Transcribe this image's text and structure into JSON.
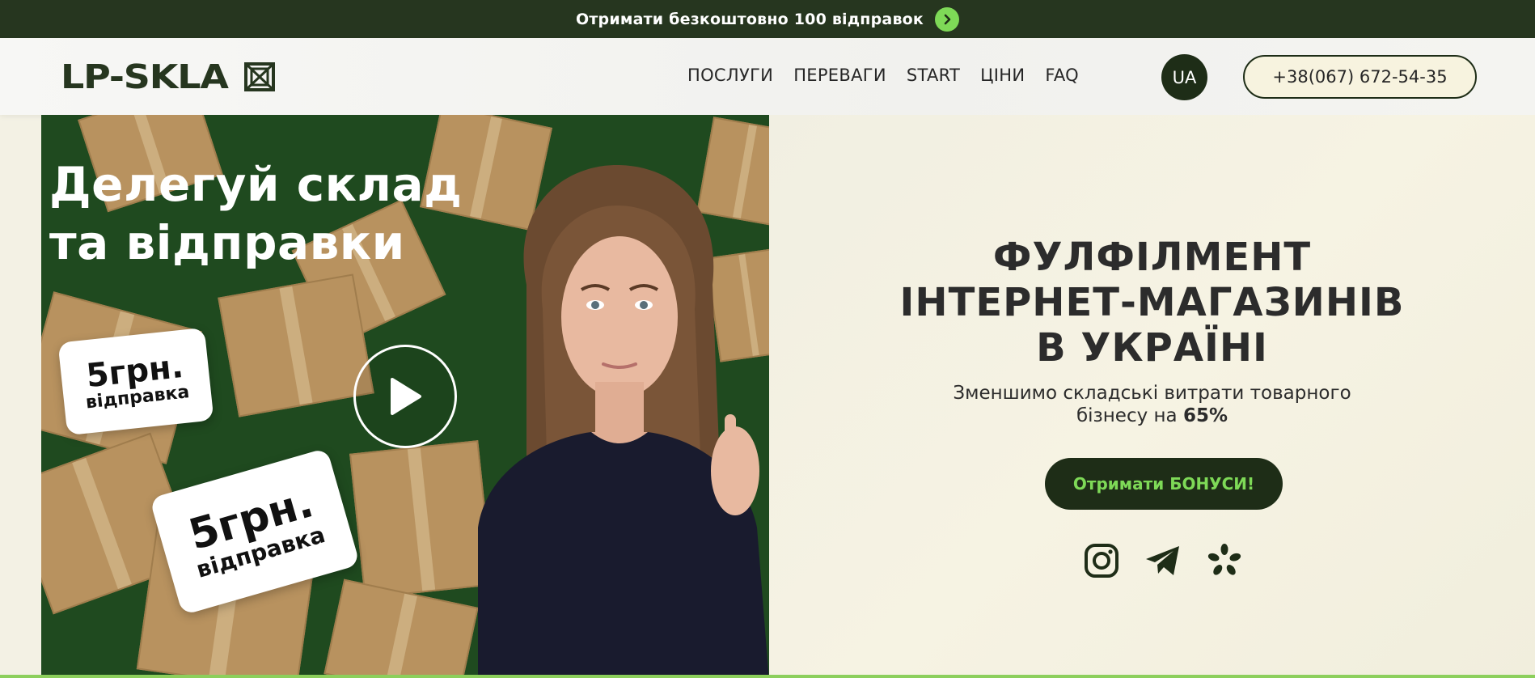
{
  "promo": {
    "text": "Отримати безкоштовно 100 відправок",
    "arrow_icon": "chevron-right-icon"
  },
  "header": {
    "logo_text": "LP-SKLA",
    "nav": [
      "ПОСЛУГИ",
      "ПЕРЕВАГИ",
      "START",
      "ЦІНИ",
      "FAQ"
    ],
    "lang": "UA",
    "phone": "+38(067) 672-54-35"
  },
  "video": {
    "title_line1": "Делегуй склад",
    "title_line2": "та відправки",
    "badge1": {
      "price": "5грн.",
      "sub": "відправка"
    },
    "badge2": {
      "price": "5грн.",
      "sub": "відправка"
    },
    "play_icon": "play-icon"
  },
  "hero": {
    "headline_line1": "ФУЛФІЛМЕНТ",
    "headline_line2": "ІНТЕРНЕТ-МАГАЗИНІВ",
    "headline_line3": "В УКРАЇНІ",
    "sub_line1": "Зменшимо складські витрати товарного",
    "sub_line2_prefix": "бізнесу на ",
    "sub_line2_bold": "65%",
    "cta": "Отримати БОНУСИ!",
    "socials": [
      "instagram-icon",
      "telegram-icon",
      "kyivstar-icon"
    ]
  },
  "colors": {
    "dark_green": "#26361f",
    "accent_green": "#7ed957",
    "cream": "#f7f3df",
    "video_bg": "#1f4a1f"
  }
}
